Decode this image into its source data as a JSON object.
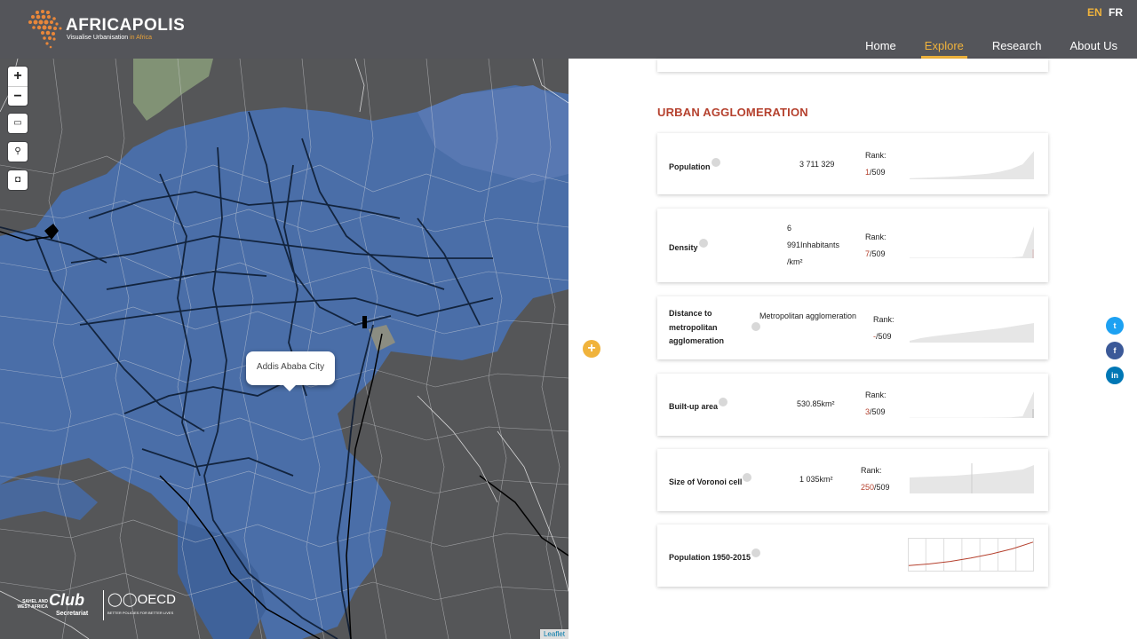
{
  "header": {
    "logo": {
      "title": "AFRICAPOLIS",
      "subtitle_a": "Visualise Urbanisation ",
      "subtitle_b": "in Africa"
    },
    "languages": {
      "en": "EN",
      "fr": "FR"
    },
    "nav": [
      {
        "label": "Home",
        "active": false
      },
      {
        "label": "Explore",
        "active": true
      },
      {
        "label": "Research",
        "active": false
      },
      {
        "label": "About Us",
        "active": false
      }
    ]
  },
  "map": {
    "zoom_in": "+",
    "zoom_out": "−",
    "popup_label": "Addis Ababa City",
    "attribution": "Leaflet",
    "partner": {
      "small_text_1": "SAHEL AND",
      "small_text_2": "WEST AFRICA",
      "club": "Club",
      "secretariat": "Secretariat",
      "oecd": "◯◯OECD",
      "oecd_tagline": "BETTER POLICIES FOR BETTER LIVES"
    },
    "colors": {
      "background": "#555658",
      "urban": "#4a6ea8",
      "roads": "#e6e6e6",
      "major_roads": "#0b1a2e"
    }
  },
  "panel": {
    "expand_button": "+",
    "section_title": "URBAN AGGLOMERATION",
    "cards": [
      {
        "label": "Population",
        "value": "3 711 329",
        "rank_label": "Rank:",
        "rank": "1",
        "rank_total": "/509",
        "spark": [
          1,
          1.5,
          2,
          2.5,
          3,
          4,
          5,
          6,
          8,
          11,
          16,
          30
        ]
      },
      {
        "label": "Density",
        "value_lines": [
          "6",
          "991Inhabitants",
          "/km²"
        ],
        "rank_label": "Rank:",
        "rank": "7",
        "rank_total": "/509",
        "spark": [
          0.5,
          0.5,
          0.5,
          0.5,
          0.5,
          0.5,
          0.5,
          0.5,
          0.6,
          0.8,
          2,
          34
        ]
      },
      {
        "label_lines": [
          "Distance to",
          "metropolitan",
          "agglomeration"
        ],
        "value": "Metropolitan agglomeration",
        "rank_label": "Rank:",
        "rank": "-",
        "rank_total": "/509",
        "spark": [
          2,
          5,
          7,
          8.5,
          10,
          11.5,
          13,
          14.5,
          16,
          18,
          20,
          22
        ]
      },
      {
        "label": "Built-up area",
        "value": "530.85km²",
        "rank_label": "Rank:",
        "rank": "3",
        "rank_total": "/509",
        "spark": [
          0.3,
          0.3,
          0.3,
          0.3,
          0.3,
          0.3,
          0.3,
          0.4,
          0.5,
          0.8,
          2,
          30
        ]
      },
      {
        "label": "Size of Voronoi cell",
        "value": "1 035km²",
        "rank_label": "Rank:",
        "rank": "250",
        "rank_total": "/509",
        "spark": [
          18,
          18.5,
          19,
          19.5,
          20,
          21,
          22,
          23,
          24,
          25.5,
          27,
          32
        ]
      },
      {
        "label": "Population 1950-2015",
        "spark_line": [
          5,
          7,
          10,
          14,
          19,
          25,
          33
        ]
      }
    ]
  },
  "share": [
    {
      "icon": "twitter-icon",
      "glyph": "t",
      "color": "#1da1f2"
    },
    {
      "icon": "facebook-icon",
      "glyph": "f",
      "color": "#3b5998"
    },
    {
      "icon": "linkedin-icon",
      "glyph": "in",
      "color": "#0077b5"
    }
  ]
}
